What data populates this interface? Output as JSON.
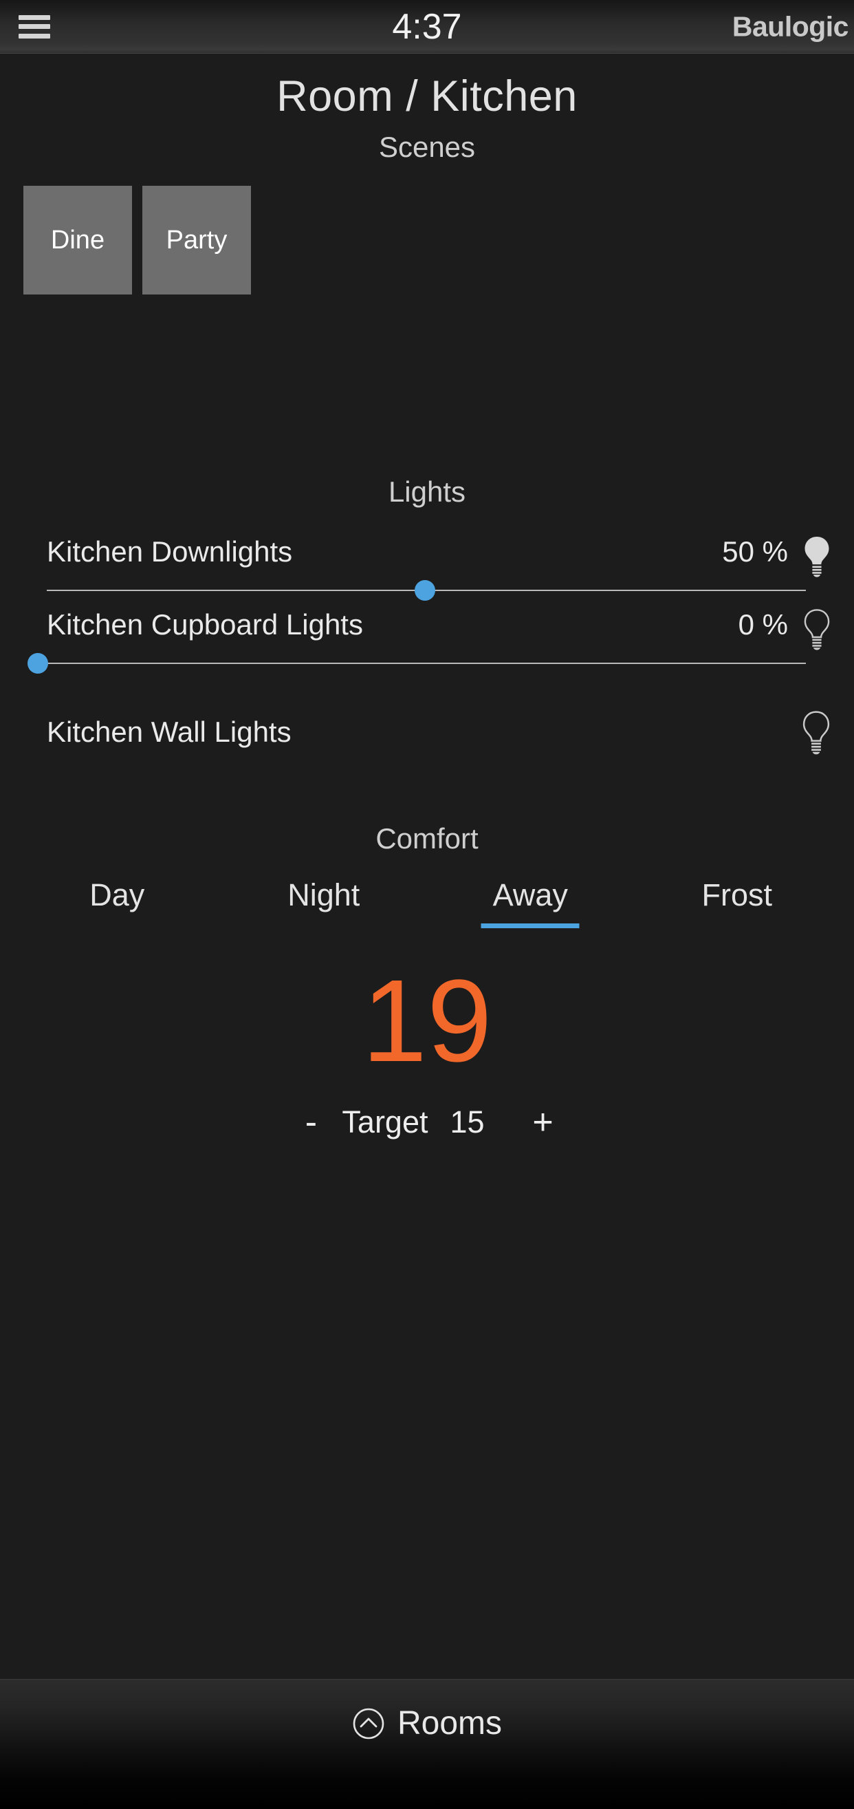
{
  "header": {
    "menu_icon": "hamburger-menu-icon",
    "clock": "4:37",
    "brand": "Baulogic"
  },
  "page": {
    "title": "Room / Kitchen"
  },
  "scenes": {
    "heading": "Scenes",
    "tiles": [
      {
        "label": "Dine",
        "color": "#6e6e6e"
      },
      {
        "label": "Party",
        "color": "#6e6e6e"
      }
    ]
  },
  "lights": {
    "heading": "Lights",
    "items": [
      {
        "name": "Kitchen Downlights",
        "percent_label": "50 %",
        "value": 50,
        "has_slider": true,
        "bulb_state": "on",
        "bulb_icon": "lightbulb-filled-icon"
      },
      {
        "name": "Kitchen Cupboard Lights",
        "percent_label": "0 %",
        "value": 0,
        "has_slider": true,
        "bulb_state": "off",
        "bulb_icon": "lightbulb-outline-icon"
      },
      {
        "name": "Kitchen Wall Lights",
        "percent_label": "",
        "value": null,
        "has_slider": false,
        "bulb_state": "off",
        "bulb_icon": "lightbulb-outline-icon"
      }
    ],
    "slider_thumb_color": "#4da3e0",
    "slider_track_color": "#b9b9b9"
  },
  "comfort": {
    "heading": "Comfort",
    "tabs": [
      {
        "label": "Day",
        "active": false
      },
      {
        "label": "Night",
        "active": false
      },
      {
        "label": "Away",
        "active": true
      },
      {
        "label": "Frost",
        "active": false
      }
    ],
    "active_indicator_color": "#4da3e0",
    "current_temperature": "19",
    "current_temperature_color": "#f2682a",
    "target_label": "Target",
    "target_value": "15",
    "decrease_label": "-",
    "increase_label": "+"
  },
  "bottom_bar": {
    "rooms_label": "Rooms",
    "rooms_icon": "chevron-up-circle-icon"
  },
  "theme": {
    "background": "#1c1c1c",
    "accent_blue": "#4da3e0",
    "accent_orange": "#f2682a",
    "tile_gray": "#6e6e6e"
  }
}
